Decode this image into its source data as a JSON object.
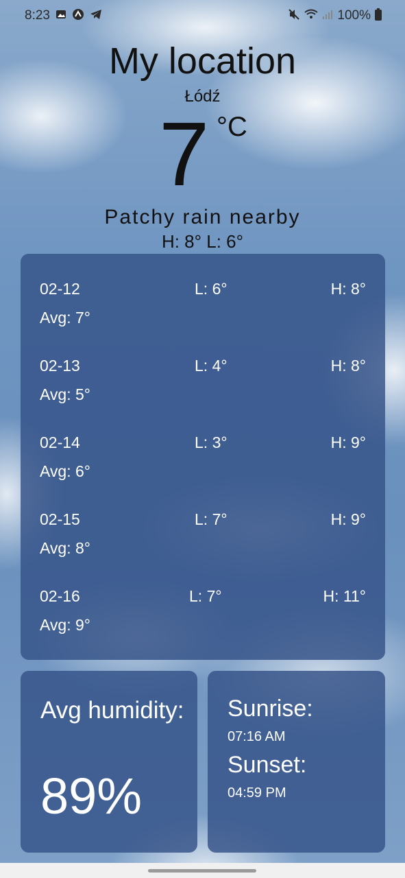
{
  "status_bar": {
    "time": "8:23",
    "left_icons": [
      "image-icon",
      "app-icon",
      "telegram-icon"
    ],
    "right_icons": [
      "mute-icon",
      "wifi-icon",
      "signal-icon",
      "battery-icon"
    ],
    "battery": "100%"
  },
  "header": {
    "title": "My location",
    "city": "Łódź",
    "temperature": "7",
    "unit": "°C",
    "condition": "Patchy rain nearby",
    "high_low": "H: 8° L: 6°"
  },
  "forecast": [
    {
      "date": "02-12",
      "low": "L: 6°",
      "high": "H: 8°",
      "avg": "Avg: 7°"
    },
    {
      "date": "02-13",
      "low": "L: 4°",
      "high": "H: 8°",
      "avg": "Avg: 5°"
    },
    {
      "date": "02-14",
      "low": "L: 3°",
      "high": "H: 9°",
      "avg": "Avg: 6°"
    },
    {
      "date": "02-15",
      "low": "L: 7°",
      "high": "H: 9°",
      "avg": "Avg: 8°"
    },
    {
      "date": "02-16",
      "low": "L: 7°",
      "high": "H: 11°",
      "avg": "Avg: 9°"
    }
  ],
  "humidity": {
    "label": "Avg humidity:",
    "value": "89%"
  },
  "sun": {
    "sunrise_label": "Sunrise:",
    "sunrise_time": "07:16 AM",
    "sunset_label": "Sunset:",
    "sunset_time": "04:59 PM"
  },
  "colors": {
    "panel": "#345287",
    "text_dark": "#111111",
    "text_light": "#ffffff"
  }
}
